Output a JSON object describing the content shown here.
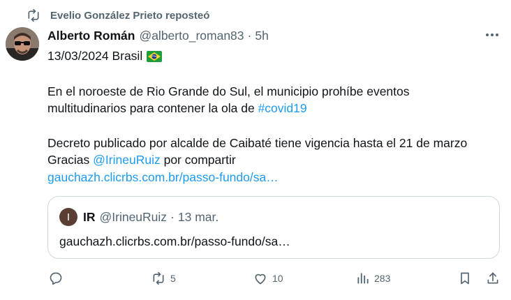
{
  "repost": {
    "text": "Evelio González Prieto reposteó",
    "icon": "repost-icon"
  },
  "author": {
    "name": "Alberto Román",
    "handle": "@alberto_roman83",
    "separator": "·",
    "time": "5h"
  },
  "tweet": {
    "line1": "13/03/2024 Brasil",
    "flag_icon": "brazil-flag-icon",
    "p2_line1": "En el noroeste de Rio Grande do Sul, el municipio prohíbe eventos",
    "p2_line2_text": "multitudinarios para contener la ola de ",
    "hashtag": "#covid19",
    "p3_line1": "Decreto publicado por alcalde de Caibaté tiene vigencia hasta el 21 de marzo",
    "p3_line2_before": "Gracias ",
    "mention": "@IrineuRuiz",
    "p3_line2_after": " por compartir",
    "link": "gauchazh.clicrbs.com.br/passo-fundo/sa…"
  },
  "quote": {
    "avatar_initial": "I",
    "name": "IR",
    "handle": "@IrineuRuiz",
    "separator": "·",
    "time": "13 mar.",
    "text": "gauchazh.clicrbs.com.br/passo-fundo/sa…"
  },
  "actions": {
    "replies": "",
    "reposts": "5",
    "likes": "10",
    "views": "283"
  },
  "colors": {
    "link": "#1d9bf0",
    "secondary_text": "#536471",
    "primary_text": "#0f1419",
    "border": "#cfd9de"
  }
}
